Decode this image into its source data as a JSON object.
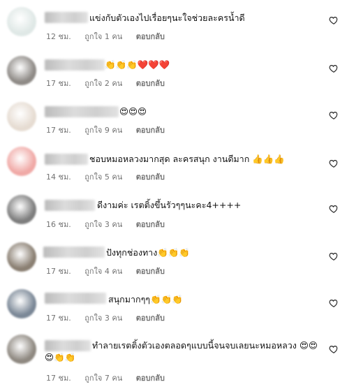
{
  "ui": {
    "heart_icon": "heart-outline-icon",
    "meta_color": "#737373"
  },
  "comments": [
    {
      "text": "แข่งกับตัวเองไปเรื่อยๆนะใจช่วยละครน้ำดี",
      "time": "12 ชม.",
      "likes": "ถูกใจ 1 คน",
      "reply": "ตอบกลับ",
      "avatar_color": "#dfe8e6"
    },
    {
      "text": "👏👏👏❤️❤️❤️",
      "time": "17 ชม.",
      "likes": "ถูกใจ 2 คน",
      "reply": "ตอบกลับ",
      "avatar_color": "#8e8a86"
    },
    {
      "text": "😍😍😍",
      "time": "17 ชม.",
      "likes": "ถูกใจ 9 คน",
      "reply": "ตอบกลับ",
      "avatar_color": "#e6dcd2"
    },
    {
      "text": "ชอบหมอหลวงมากสุด ละครสนุก งานดีมาก 👍👍👍",
      "time": "14 ชม.",
      "likes": "ถูกใจ 5 คน",
      "reply": "ตอบกลับ",
      "avatar_color": "#f0a9a6"
    },
    {
      "text": "ดีงามค่ะ เรตติ้งขึ้นรัวๆๆนะคะ4++++",
      "time": "16 ชม.",
      "likes": "ถูกใจ 3 คน",
      "reply": "ตอบกลับ",
      "avatar_color": "#7d7d7d"
    },
    {
      "text": "ปังทุกช่องทาง👏👏👏",
      "time": "17 ชม.",
      "likes": "ถูกใจ 4 คน",
      "reply": "ตอบกลับ",
      "avatar_color": "#8a7f72"
    },
    {
      "text": "สนุกมากๆๆ👏👏👏",
      "time": "17 ชม.",
      "likes": "ถูกใจ 3 คน",
      "reply": "ตอบกลับ",
      "avatar_color": "#7a8796"
    },
    {
      "text": "ทำลายเรตติ้งตัวเองตลอดๆแบบนี้จนจบเลยนะหมอหลวง 😍😍😍👏👏",
      "time": "17 ชม.",
      "likes": "ถูกใจ 7 คน",
      "reply": "ตอบกลับ",
      "avatar_color": "#8e8880"
    }
  ]
}
